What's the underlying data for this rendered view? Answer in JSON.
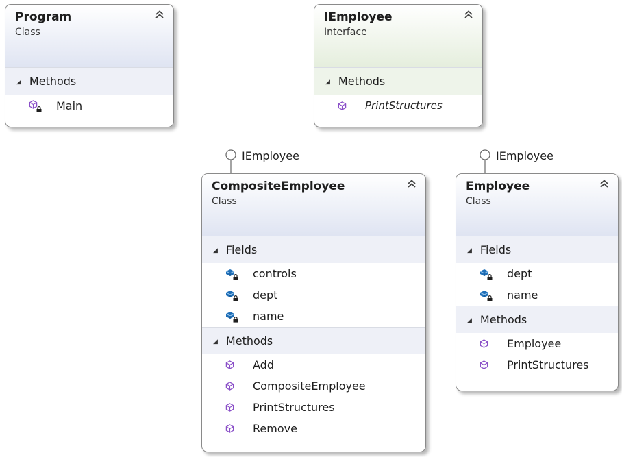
{
  "program": {
    "title": "Program",
    "stereotype": "Class",
    "sections": [
      {
        "label": "Methods",
        "members": [
          {
            "name": "Main",
            "icon": "private-method-icon"
          }
        ]
      }
    ]
  },
  "iemployee": {
    "title": "IEmployee",
    "stereotype": "Interface",
    "sections": [
      {
        "label": "Methods",
        "members": [
          {
            "name": "PrintStructures",
            "icon": "method-icon"
          }
        ]
      }
    ]
  },
  "composite": {
    "interface_label": "IEmployee",
    "title": "CompositeEmployee",
    "stereotype": "Class",
    "fields_label": "Fields",
    "fields": [
      "controls",
      "dept",
      "name"
    ],
    "methods_label": "Methods",
    "methods": [
      "Add",
      "CompositeEmployee",
      "PrintStructures",
      "Remove"
    ]
  },
  "employee": {
    "interface_label": "IEmployee",
    "title": "Employee",
    "stereotype": "Class",
    "fields_label": "Fields",
    "fields": [
      "dept",
      "name"
    ],
    "methods_label": "Methods",
    "methods": [
      "Employee",
      "PrintStructures"
    ]
  },
  "colors": {
    "class_header": "#dfe4f2",
    "interface_header": "#e5eedd",
    "method_icon": "#8a4fc8",
    "field_icon": "#1f6fb8",
    "border": "#8a8a8a"
  }
}
